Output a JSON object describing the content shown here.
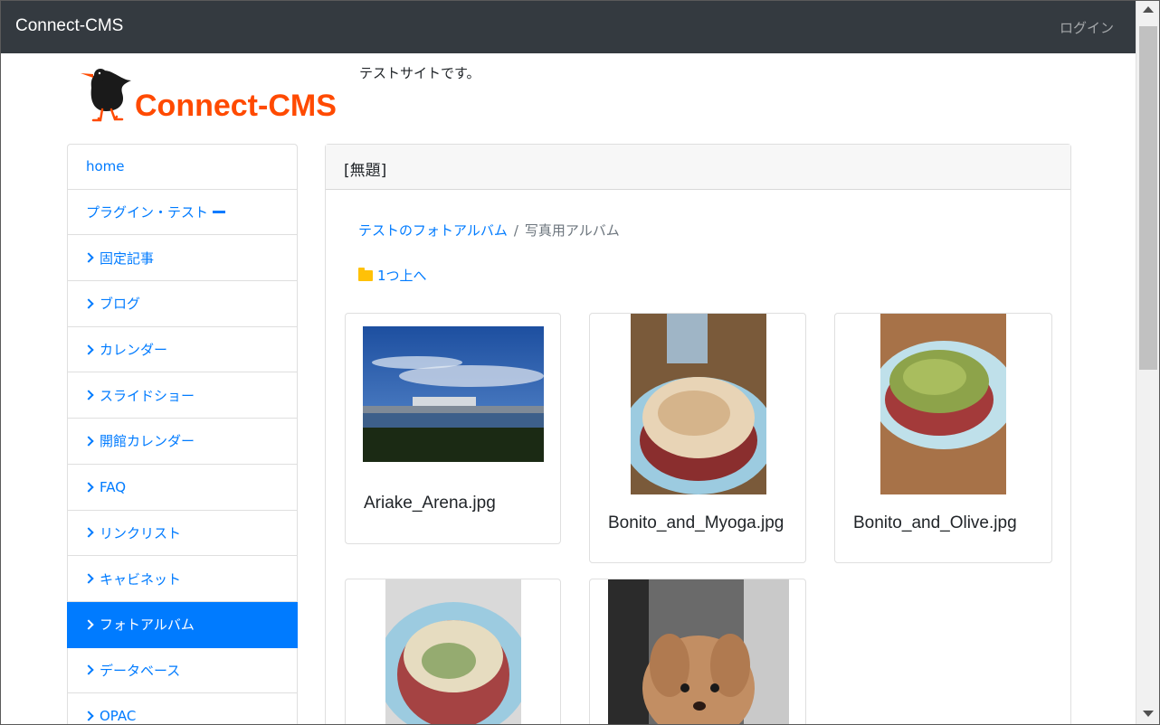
{
  "navbar": {
    "brand": "Connect-CMS",
    "login": "ログイン"
  },
  "header": {
    "logo_text": "Connect-CMS",
    "site_description": "テストサイトです。"
  },
  "sidebar": {
    "items": [
      {
        "label": "home",
        "has_chevron": false
      },
      {
        "label": "プラグイン・テスト",
        "has_chevron": false
      },
      {
        "label": "固定記事",
        "has_chevron": true
      },
      {
        "label": "ブログ",
        "has_chevron": true
      },
      {
        "label": "カレンダー",
        "has_chevron": true
      },
      {
        "label": "スライドショー",
        "has_chevron": true
      },
      {
        "label": "開館カレンダー",
        "has_chevron": true
      },
      {
        "label": "FAQ",
        "has_chevron": true
      },
      {
        "label": "リンクリスト",
        "has_chevron": true
      },
      {
        "label": "キャビネット",
        "has_chevron": true
      },
      {
        "label": "フォトアルバム",
        "has_chevron": true,
        "active": true
      },
      {
        "label": "データベース",
        "has_chevron": true
      },
      {
        "label": "OPAC",
        "has_chevron": true
      }
    ]
  },
  "main": {
    "card_title": "[無題]",
    "breadcrumb": {
      "parent": "テストのフォトアルバム",
      "separator": "/",
      "current": "写真用アルバム"
    },
    "up_link": "1つ上へ",
    "photos": [
      {
        "filename": "Ariake_Arena.jpg"
      },
      {
        "filename": "Bonito_and_Myoga.jpg"
      },
      {
        "filename": "Bonito_and_Olive.jpg"
      },
      {
        "filename": ""
      },
      {
        "filename": ""
      }
    ]
  },
  "colors": {
    "navbar": "#343a40",
    "accent": "#007bff",
    "logo_orange": "#ff4a00",
    "folder": "#ffc107"
  }
}
